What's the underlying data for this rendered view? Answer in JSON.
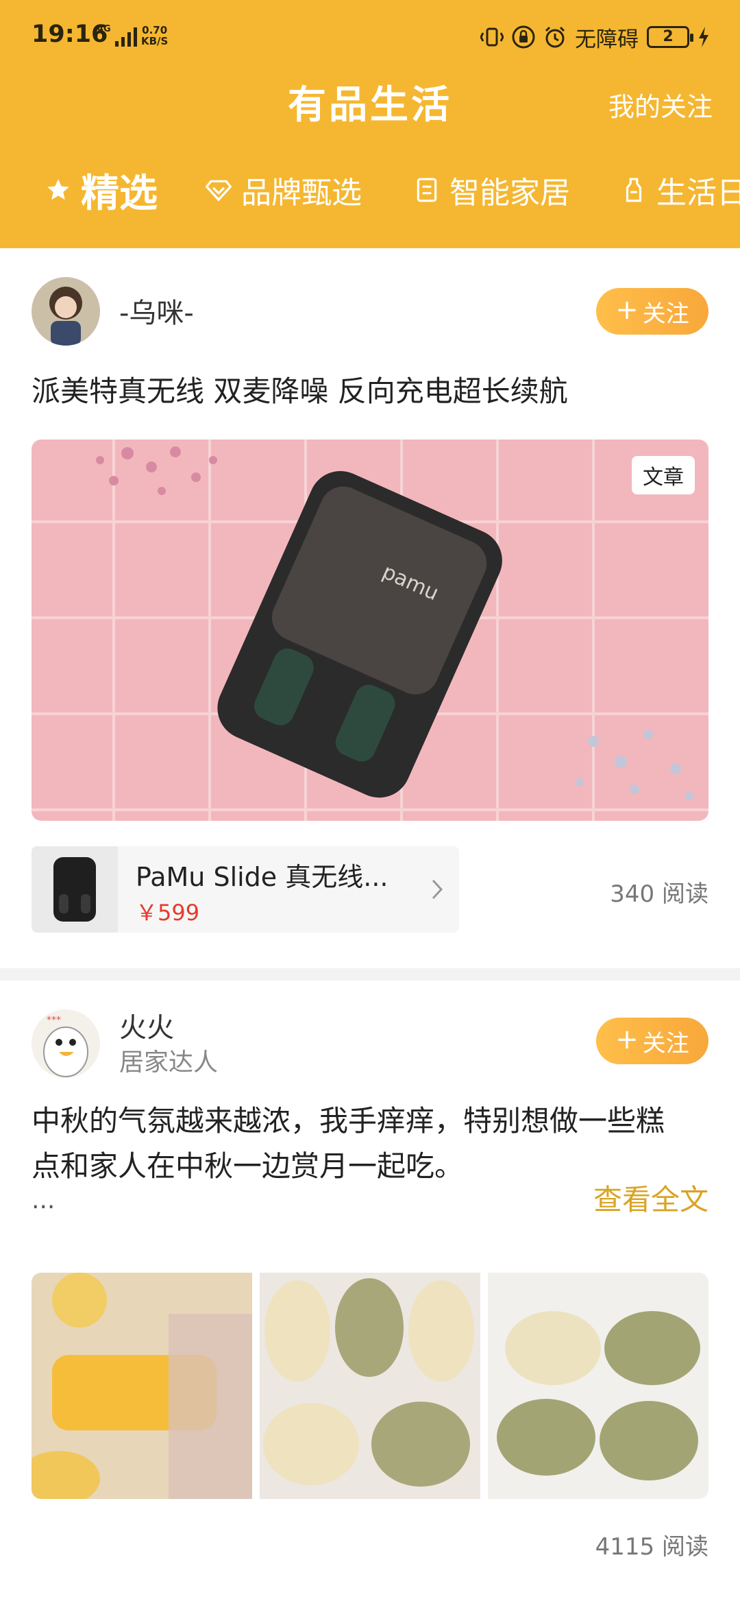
{
  "status_bar": {
    "time": "19:16",
    "network": "4G",
    "speed_value": "0.70",
    "speed_unit": "KB/S",
    "accessibility": "无障碍",
    "battery": "2"
  },
  "header": {
    "title": "有品生活",
    "follow_link": "我的关注"
  },
  "tabs": [
    {
      "label": "精选",
      "icon": "star-icon",
      "active": true
    },
    {
      "label": "品牌甄选",
      "icon": "diamond-icon",
      "active": false
    },
    {
      "label": "智能家居",
      "icon": "device-icon",
      "active": false
    },
    {
      "label": "生活日",
      "icon": "bottle-icon",
      "active": false
    }
  ],
  "posts": [
    {
      "author": "-乌咪-",
      "follow_label": "关注",
      "title": "派美特真无线 双麦降噪 反向充电超长续航",
      "badge": "文章",
      "product": {
        "name": "PaMu Slide 真无线...",
        "price": "￥599"
      },
      "reads": "340 阅读"
    },
    {
      "author": "火火",
      "author_tag": "居家达人",
      "follow_label": "关注",
      "text_line1": "中秋的气氛越来越浓，我手痒痒，特别想做一些糕",
      "text_line2": "点和家人在中秋一边赏月一起吃。",
      "ellipsis": "...",
      "read_more": "查看全文",
      "reads": "4115 阅读"
    }
  ],
  "colors": {
    "header_bg": "#f5b731",
    "follow_btn": "#f8a83a",
    "price": "#e63a2d",
    "read_more": "#d9a425"
  }
}
